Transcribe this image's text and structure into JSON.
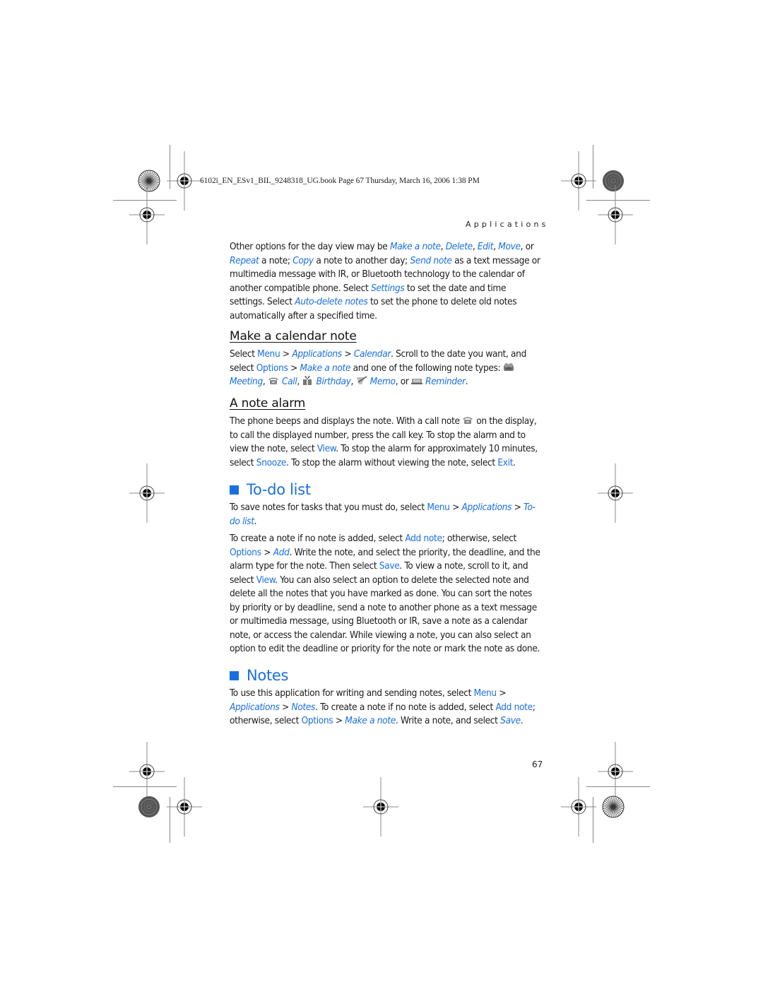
{
  "header": {
    "slug": "6102i_EN_ESv1_BIL_9248318_UG.book  Page 67  Thursday, March 16, 2006  1:38 PM",
    "running_head": "Applications"
  },
  "intro": {
    "parts": [
      {
        "t": "Other options for the day view may be "
      },
      {
        "t": "Make a note",
        "s": "hi"
      },
      {
        "t": ", "
      },
      {
        "t": "Delete",
        "s": "hi"
      },
      {
        "t": ", "
      },
      {
        "t": "Edit",
        "s": "hi"
      },
      {
        "t": ", "
      },
      {
        "t": "Move",
        "s": "hi"
      },
      {
        "t": ", or "
      },
      {
        "t": "Repeat",
        "s": "hi"
      },
      {
        "t": " a note; "
      },
      {
        "t": "Copy",
        "s": "hi"
      },
      {
        "t": " a note to another day; "
      },
      {
        "t": "Send note",
        "s": "hi"
      },
      {
        "t": " as a text message or multimedia message with IR, or Bluetooth technology to the calendar of another compatible phone. Select "
      },
      {
        "t": "Settings",
        "s": "hi"
      },
      {
        "t": " to set the date and time settings. Select "
      },
      {
        "t": "Auto-delete notes",
        "s": "hi"
      },
      {
        "t": " to set the phone to delete old notes automatically after a specified time."
      }
    ]
  },
  "make_calendar_note": {
    "heading": "Make a calendar note",
    "parts": [
      {
        "t": "Select "
      },
      {
        "t": "Menu",
        "s": "hl"
      },
      {
        "t": " > "
      },
      {
        "t": "Applications",
        "s": "hi"
      },
      {
        "t": " > "
      },
      {
        "t": "Calendar",
        "s": "hi"
      },
      {
        "t": ". Scroll to the date you want, and select "
      },
      {
        "t": "Options",
        "s": "hl"
      },
      {
        "t": " > "
      },
      {
        "t": "Make a note",
        "s": "hi"
      },
      {
        "t": " and one of the following note types: "
      },
      {
        "icon": "meeting-icon"
      },
      {
        "t": "Meeting",
        "s": "hi"
      },
      {
        "t": ", "
      },
      {
        "icon": "call-icon"
      },
      {
        "t": "Call",
        "s": "hi"
      },
      {
        "t": ", "
      },
      {
        "icon": "birthday-icon"
      },
      {
        "t": "Birthday",
        "s": "hi"
      },
      {
        "t": ", "
      },
      {
        "icon": "memo-icon"
      },
      {
        "t": "Memo",
        "s": "hi"
      },
      {
        "t": ", or "
      },
      {
        "icon": "reminder-icon"
      },
      {
        "t": "Reminder",
        "s": "hi"
      },
      {
        "t": "."
      }
    ]
  },
  "note_alarm": {
    "heading": "A note alarm",
    "parts": [
      {
        "t": "The phone beeps and displays the note. With a call note "
      },
      {
        "icon": "call-icon"
      },
      {
        "t": "on the display, to call the displayed number, press the call key. To stop the alarm and to view the note, select "
      },
      {
        "t": "View",
        "s": "hl"
      },
      {
        "t": ". To stop the alarm for approximately 10 minutes, select "
      },
      {
        "t": "Snooze",
        "s": "hl"
      },
      {
        "t": ". To stop the alarm without viewing the note, select "
      },
      {
        "t": "Exit",
        "s": "hl"
      },
      {
        "t": "."
      }
    ]
  },
  "todo": {
    "heading": "To-do list",
    "para1": [
      {
        "t": "To save notes for tasks that you must do, select "
      },
      {
        "t": "Menu",
        "s": "hl"
      },
      {
        "t": " > "
      },
      {
        "t": "Applications",
        "s": "hi"
      },
      {
        "t": " > "
      },
      {
        "t": "To-do list",
        "s": "hi"
      },
      {
        "t": "."
      }
    ],
    "para2": [
      {
        "t": "To create a note if no note is added, select "
      },
      {
        "t": "Add note",
        "s": "hl"
      },
      {
        "t": "; otherwise, select "
      },
      {
        "t": "Options",
        "s": "hl"
      },
      {
        "t": " > "
      },
      {
        "t": "Add",
        "s": "hi"
      },
      {
        "t": ". Write the note, and select the priority, the deadline, and the alarm type for the note. Then select "
      },
      {
        "t": "Save",
        "s": "hl"
      },
      {
        "t": ". To view a note, scroll to it, and select "
      },
      {
        "t": "View",
        "s": "hl"
      },
      {
        "t": ". You can also select an option to delete the selected note and delete all the notes that you have marked as done. You can sort the notes by priority or by deadline, send a note to another phone as a text message or multimedia message, using Bluetooth or IR, save a note as a calendar note, or access the calendar. While viewing a note, you can also select an option to edit the deadline or priority for the note or mark the note as done."
      }
    ]
  },
  "notes": {
    "heading": "Notes",
    "parts": [
      {
        "t": "To use this application for writing and sending notes, select "
      },
      {
        "t": "Menu",
        "s": "hl"
      },
      {
        "t": " > "
      },
      {
        "t": "Applications",
        "s": "hi"
      },
      {
        "t": " > "
      },
      {
        "t": "Notes",
        "s": "hi"
      },
      {
        "t": ". To create a note if no note is added, select "
      },
      {
        "t": "Add note",
        "s": "hl"
      },
      {
        "t": "; otherwise, select "
      },
      {
        "t": "Options",
        "s": "hl"
      },
      {
        "t": " > "
      },
      {
        "t": "Make a note",
        "s": "hi"
      },
      {
        "t": ". Write a note, and select "
      },
      {
        "t": "Save",
        "s": "hi"
      },
      {
        "t": "."
      }
    ]
  },
  "footer": {
    "page_number": "67"
  },
  "colors": {
    "accent": "#1a6fe0",
    "text": "#1a1a1a",
    "marks": "#888888"
  }
}
